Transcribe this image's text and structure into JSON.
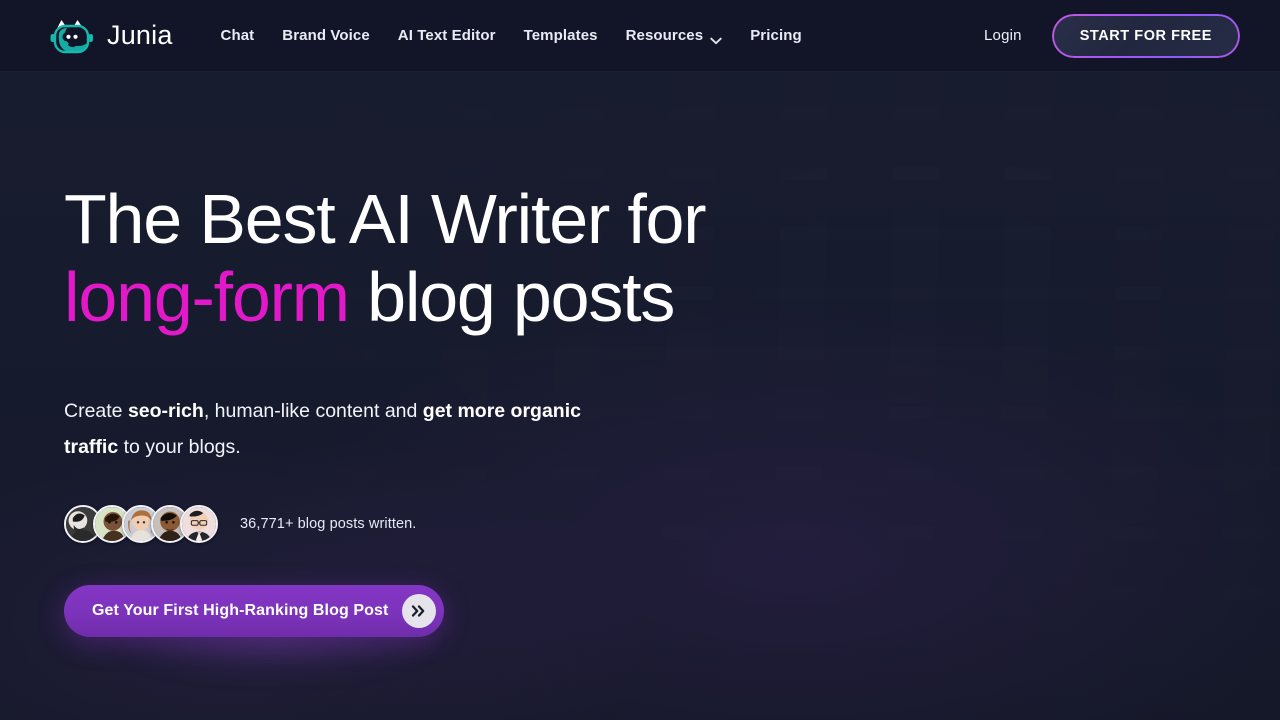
{
  "header": {
    "brand": {
      "name": "Junia",
      "logo_icon": "junia-cat-robot-logo",
      "logo_color": "#16b8ae"
    },
    "nav": [
      {
        "label": "Chat",
        "has_dropdown": false
      },
      {
        "label": "Brand Voice",
        "has_dropdown": false
      },
      {
        "label": "AI Text Editor",
        "has_dropdown": false
      },
      {
        "label": "Templates",
        "has_dropdown": false
      },
      {
        "label": "Resources",
        "has_dropdown": true,
        "dropdown_icon": "chevron-down-icon"
      },
      {
        "label": "Pricing",
        "has_dropdown": false
      }
    ],
    "login_label": "Login",
    "signup_label": "START FOR FREE",
    "signup_border_color": "#a855f7",
    "background_color": "#111527"
  },
  "hero": {
    "headline_line1": "The Best AI Writer for",
    "headline_accent": "long-form",
    "headline_line2_rest": " blog posts",
    "accent_color": "#e219c9",
    "subhead": {
      "part1": "Create ",
      "bold1": "seo-rich",
      "part2": ", human-like content and ",
      "bold2": "get more organic traffic",
      "part3": " to your blogs."
    },
    "social_proof_text": "36,771+ blog posts written.",
    "avatar_count": 5,
    "cta_label": "Get Your First High-Ranking Blog Post",
    "cta_icon": "double-chevron-right-icon",
    "cta_color": "#7c33bb",
    "background_color": "#171b2e"
  }
}
